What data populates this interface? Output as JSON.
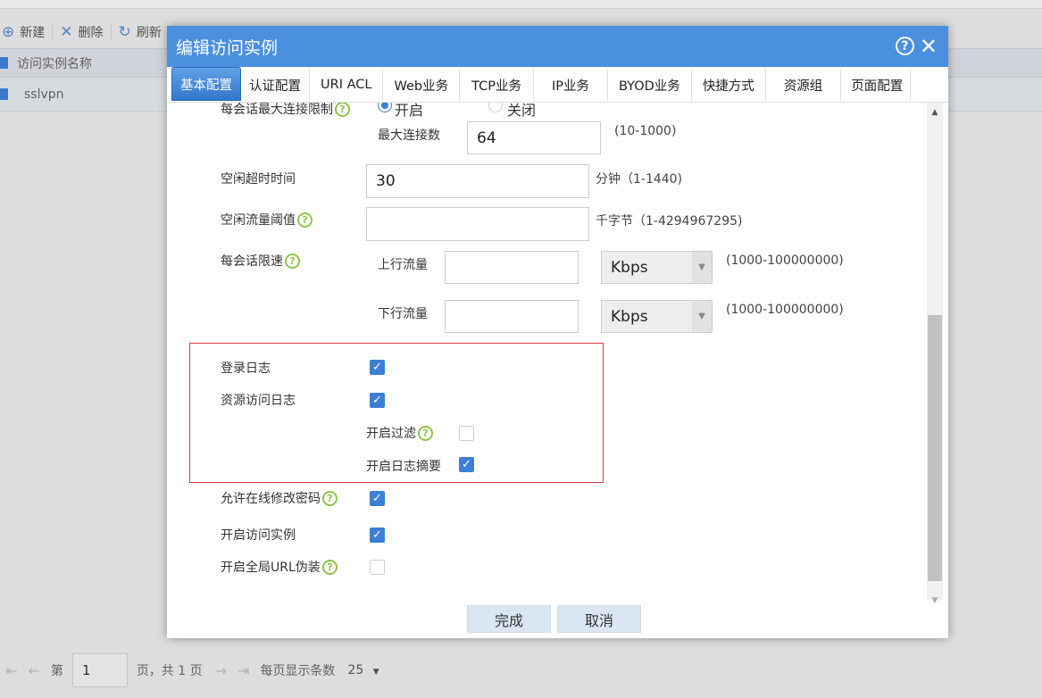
{
  "toolbar": {
    "new_label": "新建",
    "delete_label": "删除",
    "refresh_label": "刷新"
  },
  "table": {
    "header": "访问实例名称",
    "rows": [
      "sslvpn"
    ]
  },
  "pager": {
    "page_prefix": "第",
    "page_value": "1",
    "page_suffix": "页，共 1 页",
    "per_page_label": "每页显示条数",
    "per_page_value": "25"
  },
  "dialog": {
    "title": "编辑访问实例",
    "tabs": [
      "基本配置",
      "认证配置",
      "URI ACL",
      "Web业务",
      "TCP业务",
      "IP业务",
      "BYOD业务",
      "快捷方式",
      "资源组",
      "页面配置"
    ],
    "active_tab": "基本配置",
    "form": {
      "max_conn_limit_label": "每会话最大连接限制",
      "radio_on_label": "开启",
      "radio_off_label": "关闭",
      "max_conn_count_label": "最大连接数",
      "max_conn_count_value": "64",
      "max_conn_count_hint": "(10-1000)",
      "idle_timeout_label": "空闲超时时间",
      "idle_timeout_value": "30",
      "idle_timeout_hint": "分钟（1-1440)",
      "idle_traffic_label": "空闲流量阈值",
      "idle_traffic_value": "",
      "idle_traffic_hint": "千字节（1-4294967295)",
      "session_rate_label": "每会话限速",
      "upstream_label": "上行流量",
      "upstream_value": "",
      "upstream_unit": "Kbps",
      "upstream_hint": "(1000-100000000)",
      "downstream_label": "下行流量",
      "downstream_value": "",
      "downstream_unit": "Kbps",
      "downstream_hint": "(1000-100000000)",
      "login_log_label": "登录日志",
      "resource_log_label": "资源访问日志",
      "enable_filter_label": "开启过滤",
      "enable_log_summary_label": "开启日志摘要",
      "allow_pwd_change_label": "允许在线修改密码",
      "enable_instance_label": "开启访问实例",
      "enable_url_masq_label": "开启全局URL伪装"
    },
    "ok_label": "完成",
    "cancel_label": "取消"
  },
  "colors": {
    "title_bar": "#4a90df",
    "checkbox": "#3c7fd8",
    "help_icon": "#8fc44a",
    "highlight_box": "#e03c3c"
  }
}
